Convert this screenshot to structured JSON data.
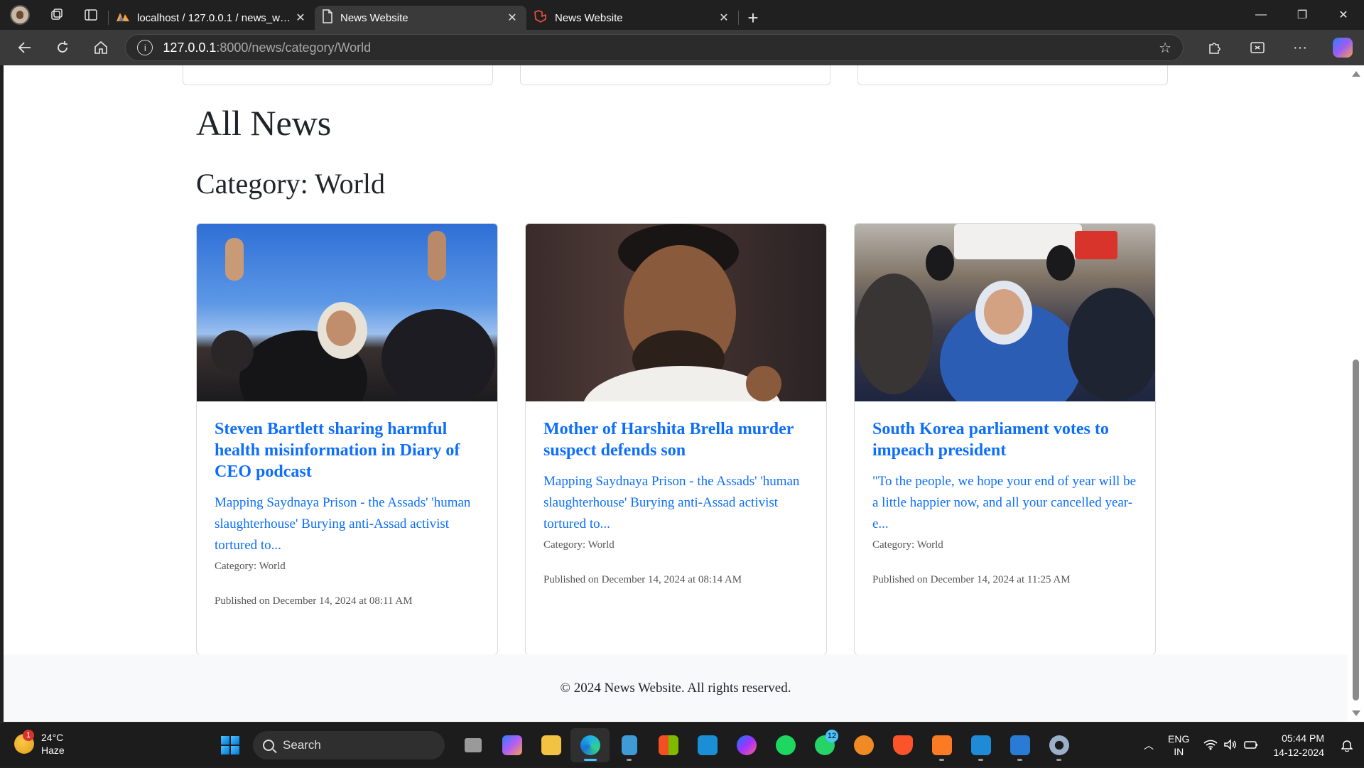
{
  "browser": {
    "tabs": [
      {
        "title": "localhost / 127.0.0.1 / news_website",
        "icon": "phpmyadmin-icon",
        "active": false
      },
      {
        "title": "News Website",
        "icon": "document-icon",
        "active": true
      },
      {
        "title": "News Website",
        "icon": "laravel-icon",
        "active": false
      }
    ],
    "url_host": "127.0.0.1",
    "url_rest": ":8000/news/category/World"
  },
  "page": {
    "heading": "All News",
    "category_heading": "Category: World",
    "articles": [
      {
        "title": "Steven Bartlett sharing harmful health misinformation in Diary of CEO podcast",
        "summary": "Mapping Saydnaya Prison - the Assads' 'human slaughterhouse' Burying anti-Assad activist tortured to...",
        "category": "Category: World",
        "published": "Published on December 14, 2024 at 08:11 AM"
      },
      {
        "title": "Mother of Harshita Brella murder suspect defends son",
        "summary": "Mapping Saydnaya Prison - the Assads' 'human slaughterhouse' Burying anti-Assad activist tortured to...",
        "category": "Category: World",
        "published": "Published on December 14, 2024 at 08:14 AM"
      },
      {
        "title": "South Korea parliament votes to impeach president",
        "summary": "\"To the people, we hope your end of year will be a little happier now, and all your cancelled year-e...",
        "category": "Category: World",
        "published": "Published on December 14, 2024 at 11:25 AM"
      }
    ],
    "footer": "© 2024 News Website. All rights reserved."
  },
  "taskbar": {
    "weather_temp": "24°C",
    "weather_desc": "Haze",
    "weather_badge": "1",
    "search_placeholder": "Search",
    "whatsapp_badge": "12",
    "lang_line1": "ENG",
    "lang_line2": "IN",
    "time": "05:44 PM",
    "date": "14-12-2024"
  },
  "colors": {
    "link_blue": "#0d6efd",
    "text_dark": "#212529",
    "footer_bg": "#f8f9fa"
  }
}
